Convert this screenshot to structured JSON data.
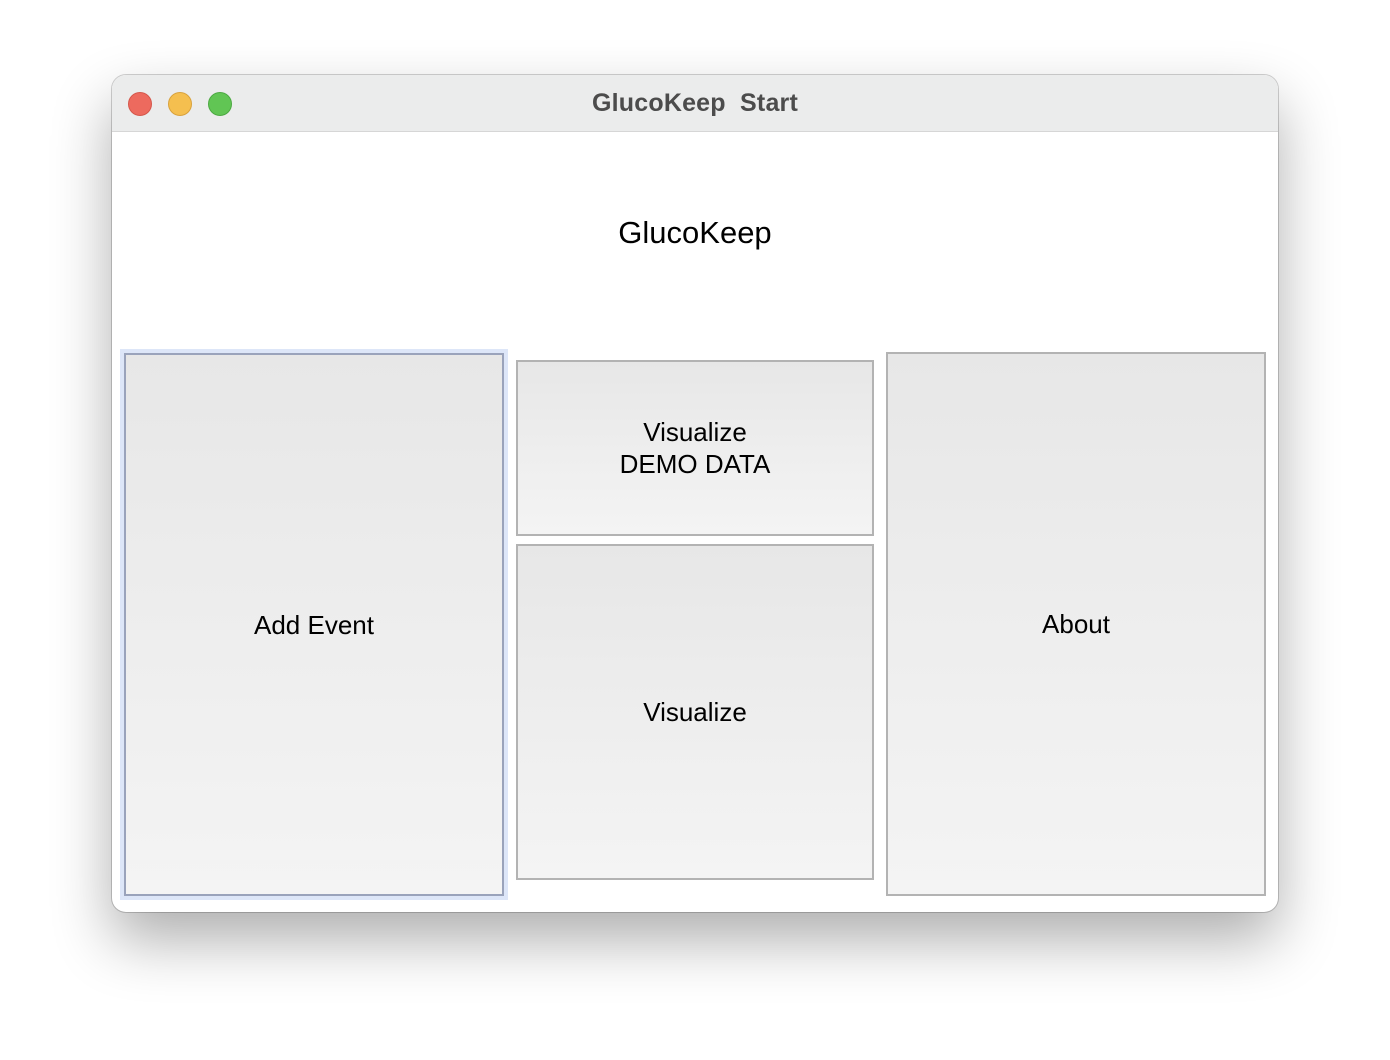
{
  "window": {
    "title": "GlucoKeep  Start"
  },
  "main": {
    "heading": "GlucoKeep",
    "buttons": {
      "add_event": "Add Event",
      "visualize_demo": "Visualize\nDEMO DATA",
      "visualize": "Visualize",
      "about": "About"
    }
  },
  "colors": {
    "close": "#ed6a5e",
    "minimize": "#f5bf4f",
    "zoom": "#61c554"
  }
}
